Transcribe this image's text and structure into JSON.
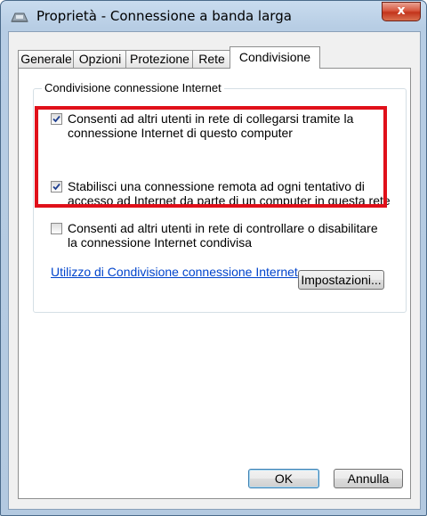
{
  "window": {
    "title": "Proprietà - Connessione a banda larga",
    "close_glyph": "x",
    "title_icon": "network-connection-icon"
  },
  "tabs": [
    {
      "label": "Generale",
      "active": false
    },
    {
      "label": "Opzioni",
      "active": false
    },
    {
      "label": "Protezione",
      "active": false
    },
    {
      "label": "Rete",
      "active": false
    },
    {
      "label": "Condivisione",
      "active": true
    }
  ],
  "group": {
    "label": "Condivisione connessione Internet",
    "options": [
      {
        "checked": true,
        "lines": [
          "Consenti ad altri utenti in rete di collegarsi tramite la",
          "connessione Internet di questo computer"
        ]
      },
      {
        "checked": true,
        "lines": [
          "Stabilisci una connessione remota ad ogni tentativo di",
          "accesso ad Internet da parte di un computer in questa rete"
        ]
      },
      {
        "checked": false,
        "lines": [
          "Consenti ad altri utenti in rete di controllare o disabilitare",
          "la connessione Internet condivisa"
        ]
      }
    ],
    "link": "Utilizzo di Condivisione connessione Internet",
    "settings_button": "Impostazioni..."
  },
  "footer": {
    "ok": "OK",
    "cancel": "Annulla"
  },
  "colors": {
    "highlight": "#e0101a",
    "link": "#0044cc"
  }
}
